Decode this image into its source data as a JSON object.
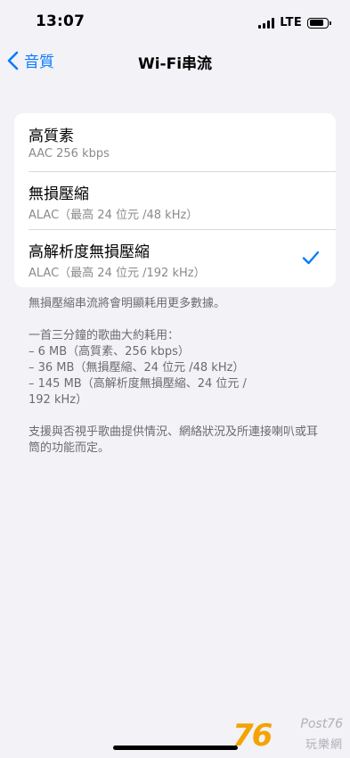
{
  "status_bar": {
    "time": "13:07",
    "network": "LTE"
  },
  "nav": {
    "back_label": "音質",
    "title": "Wi-Fi串流"
  },
  "options": [
    {
      "title": "高質素",
      "subtitle": "AAC 256 kbps",
      "selected": false
    },
    {
      "title": "無損壓縮",
      "subtitle": "ALAC（最高 24 位元 /48 kHz）",
      "selected": false
    },
    {
      "title": "高解析度無損壓縮",
      "subtitle": "ALAC（最高 24 位元 /192 kHz）",
      "selected": true
    }
  ],
  "footer": {
    "note_data": "無損壓縮串流將會明顯耗用更多數據。",
    "usage_intro": "一首三分鐘的歌曲大約耗用：",
    "usage_lines": [
      "– 6 MB（高質素、256 kbps）",
      "– 36 MB（無損壓縮、24 位元 /48 kHz）",
      "– 145 MB（高解析度無損壓縮、24 位元 /",
      "192 kHz）"
    ],
    "note_support": "支援與否視乎歌曲提供情況、網絡狀況及所連接喇叭或耳筒的功能而定。"
  },
  "watermark": {
    "number": "76",
    "brand": "Post76",
    "sub": "玩樂網"
  },
  "colors": {
    "accent": "#0A7AFF",
    "background": "#F2F2F7",
    "secondary_text": "#8A8A8E"
  }
}
